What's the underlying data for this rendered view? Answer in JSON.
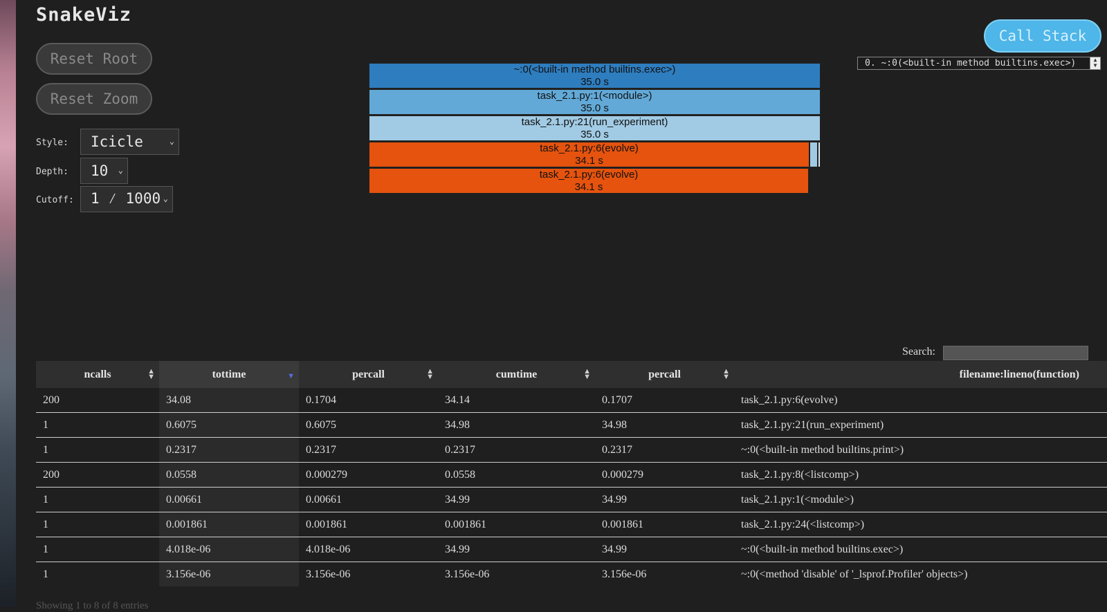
{
  "app": {
    "title": "SnakeViz"
  },
  "controls": {
    "reset_root": "Reset Root",
    "reset_zoom": "Reset Zoom",
    "style_label": "Style:",
    "style_value": "Icicle",
    "depth_label": "Depth:",
    "depth_value": "10",
    "cutoff_label": "Cutoff:",
    "cutoff_value": "1 ⁄ 1000"
  },
  "call_stack": {
    "button": "Call Stack",
    "selected": "0. ~:0(<built-in method builtins.exec>)"
  },
  "icicle": [
    {
      "name": "~:0(<built-in method builtins.exec>)",
      "time": "35.0 s",
      "color": "#2e7dbf"
    },
    {
      "name": "task_2.1.py:1(<module>)",
      "time": "35.0 s",
      "color": "#62a9d8"
    },
    {
      "name": "task_2.1.py:21(run_experiment)",
      "time": "35.0 s",
      "color": "#a1cbe4"
    },
    {
      "name": "task_2.1.py:6(evolve)",
      "time": "34.1 s",
      "color": "#e5530e"
    },
    {
      "name": "task_2.1.py:6(evolve)",
      "time": "34.1 s",
      "color": "#e5530e"
    }
  ],
  "search": {
    "label": "Search:"
  },
  "table": {
    "headers": [
      "ncalls",
      "tottime",
      "percall",
      "cumtime",
      "percall",
      "filename:lineno(function)"
    ],
    "rows": [
      [
        "200",
        "34.08",
        "0.1704",
        "34.14",
        "0.1707",
        "task_2.1.py:6(evolve)"
      ],
      [
        "1",
        "0.6075",
        "0.6075",
        "34.98",
        "34.98",
        "task_2.1.py:21(run_experiment)"
      ],
      [
        "1",
        "0.2317",
        "0.2317",
        "0.2317",
        "0.2317",
        "~:0(<built-in method builtins.print>)"
      ],
      [
        "200",
        "0.0558",
        "0.000279",
        "0.0558",
        "0.000279",
        "task_2.1.py:8(<listcomp>)"
      ],
      [
        "1",
        "0.00661",
        "0.00661",
        "34.99",
        "34.99",
        "task_2.1.py:1(<module>)"
      ],
      [
        "1",
        "0.001861",
        "0.001861",
        "0.001861",
        "0.001861",
        "task_2.1.py:24(<listcomp>)"
      ],
      [
        "1",
        "4.018e-06",
        "4.018e-06",
        "34.99",
        "34.99",
        "~:0(<built-in method builtins.exec>)"
      ],
      [
        "1",
        "3.156e-06",
        "3.156e-06",
        "3.156e-06",
        "3.156e-06",
        "~:0(<method 'disable' of '_lsprof.Profiler' objects>)"
      ]
    ],
    "footer": "Showing 1 to 8 of 8 entries"
  }
}
